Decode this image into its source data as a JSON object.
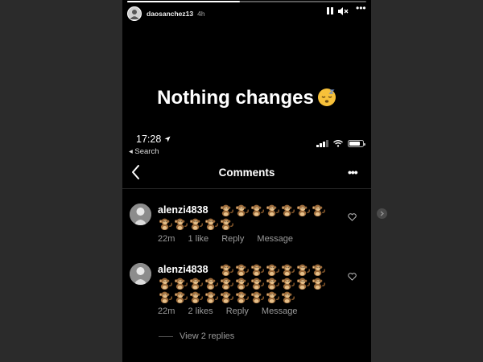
{
  "story": {
    "username": "daosanchez13",
    "time": "4h",
    "progress": 0.47,
    "caption": "Nothing changes",
    "caption_emoji": "sleeping-face"
  },
  "screenshot": {
    "status_time": "17:28",
    "back_app": "◂ Search",
    "signal_bars": 3,
    "battery_level": 0.85,
    "nav_title": "Comments"
  },
  "comments": [
    {
      "username": "alenzi4838",
      "emoji": "monkey",
      "emoji_count": 12,
      "time": "22m",
      "likes": "1 like",
      "reply": "Reply",
      "message": "Message"
    },
    {
      "username": "alenzi4838",
      "emoji": "monkey",
      "emoji_count": 27,
      "time": "22m",
      "likes": "2 likes",
      "reply": "Reply",
      "message": "Message",
      "view_replies": "View 2 replies"
    }
  ],
  "colors": {
    "background": "#2b2b2b",
    "story_bg": "#000000",
    "meta_text": "#9a9a9a"
  }
}
